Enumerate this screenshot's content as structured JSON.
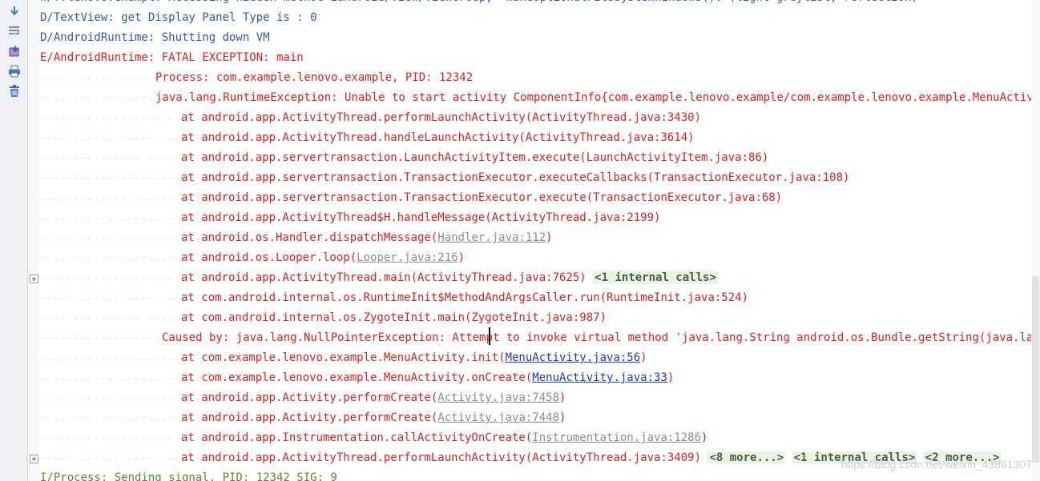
{
  "colors": {
    "info": "#2a5db0",
    "error": "#e0201c",
    "fold_bg": "#e8f4e2"
  },
  "toolbar": {
    "icons": [
      "scroll-to-end-icon",
      "soft-wrap-icon",
      "import-export-icon",
      "print-icon",
      "clear-all-icon"
    ]
  },
  "lines": [
    {
      "indent": 0,
      "cls": "blue",
      "parts": [
        {
          "t": "W/?.lenovo.exampl: Accessing hidden method Landroid/view/ViewGroup;->makeOptionalFitsSystemWindows()V (light greylist, reflection)"
        }
      ]
    },
    {
      "indent": 0,
      "cls": "blue",
      "parts": [
        {
          "t": "D/TextView: get Display Panel Type is : 0"
        }
      ]
    },
    {
      "indent": 0,
      "cls": "blue",
      "parts": [
        {
          "t": "D/AndroidRuntime: Shutting down VM"
        }
      ]
    },
    {
      "indent": 0,
      "cls": "red",
      "parts": [
        {
          "t": "E/AndroidRuntime: FATAL EXCEPTION: main"
        }
      ]
    },
    {
      "indent": 144,
      "cls": "red",
      "parts": [
        {
          "t": "Process: com.example.lenovo.example, PID: 12342"
        }
      ]
    },
    {
      "indent": 144,
      "cls": "red",
      "parts": [
        {
          "t": "java.lang.RuntimeException: Unable to start activity ComponentInfo{com.example.lenovo.example/com.example.lenovo.example.MenuActivity}: java.lang.NullPointerException"
        }
      ]
    },
    {
      "indent": 176,
      "cls": "red",
      "parts": [
        {
          "t": "at android.app.ActivityThread.performLaunchActivity(ActivityThread.java:3430)"
        }
      ]
    },
    {
      "indent": 176,
      "cls": "red",
      "parts": [
        {
          "t": "at android.app.ActivityThread.handleLaunchActivity(ActivityThread.java:3614)"
        }
      ]
    },
    {
      "indent": 176,
      "cls": "red",
      "parts": [
        {
          "t": "at android.app.servertransaction.LaunchActivityItem.execute(LaunchActivityItem.java:86)"
        }
      ]
    },
    {
      "indent": 176,
      "cls": "red",
      "parts": [
        {
          "t": "at android.app.servertransaction.TransactionExecutor.executeCallbacks(TransactionExecutor.java:108)"
        }
      ]
    },
    {
      "indent": 176,
      "cls": "red",
      "parts": [
        {
          "t": "at android.app.servertransaction.TransactionExecutor.execute(TransactionExecutor.java:68)"
        }
      ]
    },
    {
      "indent": 176,
      "cls": "red",
      "parts": [
        {
          "t": "at android.app.ActivityThread$H.handleMessage(ActivityThread.java:2199)"
        }
      ]
    },
    {
      "indent": 176,
      "cls": "red",
      "parts": [
        {
          "t": "at android.os.Handler.dispatchMessage("
        },
        {
          "t": "Handler.java:112",
          "link": "gray"
        },
        {
          "t": ")"
        }
      ]
    },
    {
      "indent": 176,
      "cls": "red",
      "parts": [
        {
          "t": "at android.os.Looper.loop("
        },
        {
          "t": "Looper.java:216",
          "link": "gray"
        },
        {
          "t": ")"
        }
      ]
    },
    {
      "indent": 176,
      "cls": "red",
      "fold": true,
      "parts": [
        {
          "t": "at android.app.ActivityThread.main(ActivityThread.java:7625) "
        },
        {
          "t": "<1 internal calls>",
          "chip": true
        }
      ]
    },
    {
      "indent": 176,
      "cls": "red",
      "parts": [
        {
          "t": "at com.android.internal.os.RuntimeInit$MethodAndArgsCaller.run(RuntimeInit.java:524)"
        }
      ]
    },
    {
      "indent": 176,
      "cls": "red",
      "parts": [
        {
          "t": "at com.android.internal.os.ZygoteInit.main(ZygoteInit.java:987)"
        }
      ]
    },
    {
      "indent": 152,
      "cls": "red",
      "parts": [
        {
          "t": "Caused by: java.lang.NullPointerException: Attempt to invoke virtual method 'java.lang.String android.os.Bundle.getString(java.lang.String)' on a null object reference"
        }
      ]
    },
    {
      "indent": 176,
      "cls": "red",
      "parts": [
        {
          "t": "at com.example.lenovo.example.MenuActivity.init("
        },
        {
          "t": "MenuActivity.java:56",
          "link": "blue"
        },
        {
          "t": ")"
        }
      ]
    },
    {
      "indent": 176,
      "cls": "red",
      "parts": [
        {
          "t": "at com.example.lenovo.example.MenuActivity.onCreate("
        },
        {
          "t": "MenuActivity.java:33",
          "link": "blue"
        },
        {
          "t": ")"
        }
      ]
    },
    {
      "indent": 176,
      "cls": "red",
      "parts": [
        {
          "t": "at android.app.Activity.performCreate("
        },
        {
          "t": "Activity.java:7458",
          "link": "gray"
        },
        {
          "t": ")"
        }
      ]
    },
    {
      "indent": 176,
      "cls": "red",
      "parts": [
        {
          "t": "at android.app.Activity.performCreate("
        },
        {
          "t": "Activity.java:7448",
          "link": "gray"
        },
        {
          "t": ")"
        }
      ]
    },
    {
      "indent": 176,
      "cls": "red",
      "parts": [
        {
          "t": "at android.app.Instrumentation.callActivityOnCreate("
        },
        {
          "t": "Instrumentation.java:1286",
          "link": "gray"
        },
        {
          "t": ")"
        }
      ]
    },
    {
      "indent": 176,
      "cls": "red",
      "fold": true,
      "parts": [
        {
          "t": "at android.app.ActivityThread.performLaunchActivity(ActivityThread.java:3409) "
        },
        {
          "t": "<8 more...>",
          "chip": true
        },
        {
          "t": " "
        },
        {
          "t": "<1 internal calls>",
          "chip": true
        },
        {
          "t": " "
        },
        {
          "t": "<2 more...>",
          "chip": true
        }
      ]
    },
    {
      "indent": 0,
      "cls": "green",
      "parts": [
        {
          "t": "I/Process: Sending signal. PID: 12342 SIG: 9"
        }
      ]
    }
  ],
  "watermark": "https://blog.csdn.net/weixin_43861307"
}
